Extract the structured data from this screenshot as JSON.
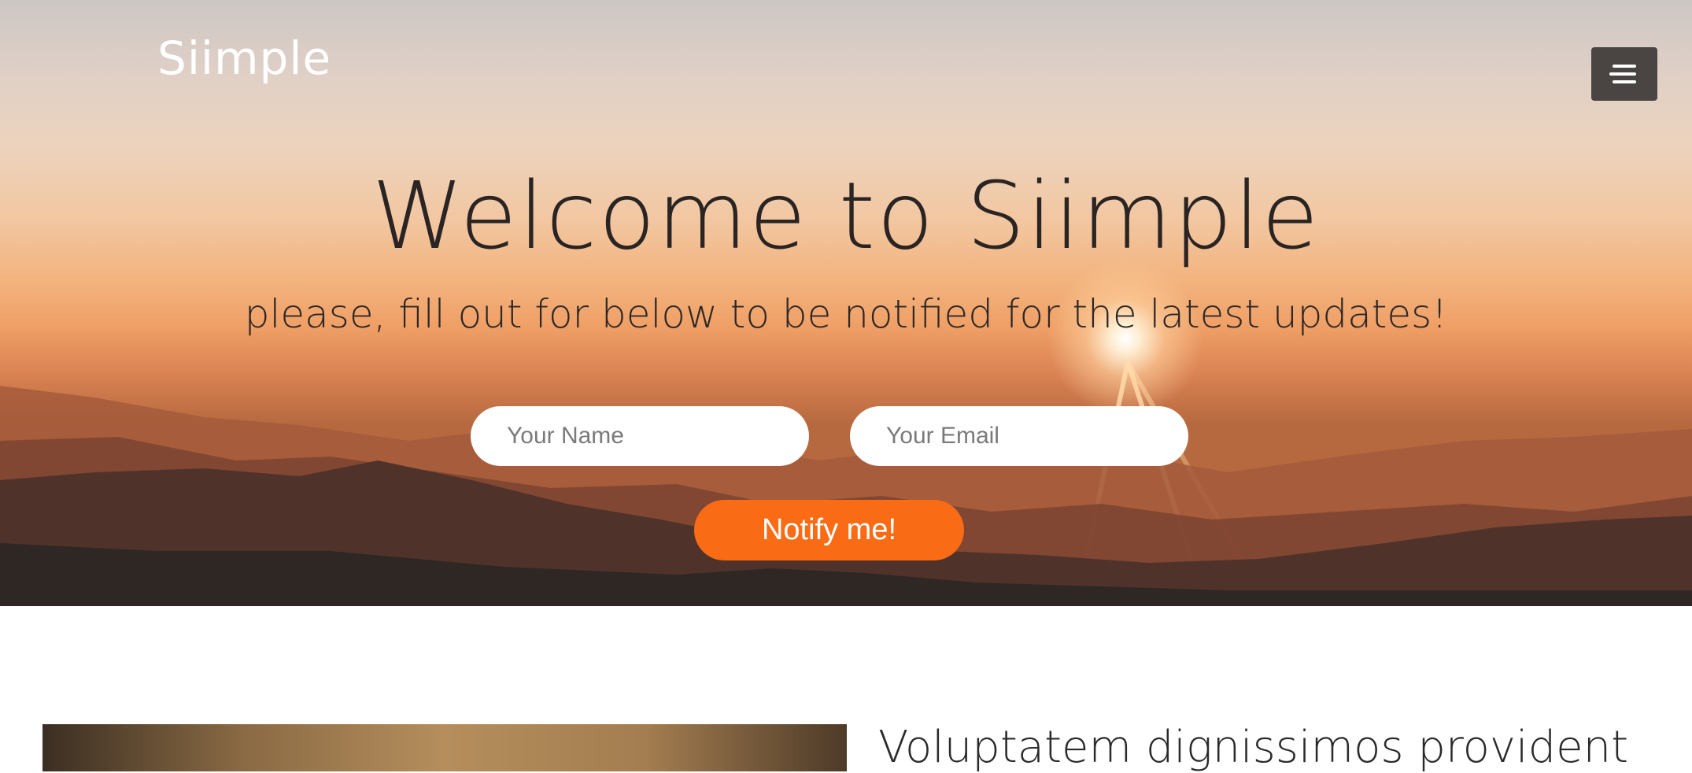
{
  "brand": {
    "logo_text": "Siimple"
  },
  "header": {
    "menu_icon": "hamburger-menu-icon"
  },
  "hero": {
    "title": "Welcome to Siimple",
    "subtitle": "please, fill out for below to be notified for the latest updates!",
    "form": {
      "name_placeholder": "Your Name",
      "email_placeholder": "Your Email",
      "submit_label": "Notify me!"
    }
  },
  "feature": {
    "heading": "Voluptatem dignissimos provident"
  },
  "colors": {
    "accent": "#f96b15",
    "menu_button": "#4a4543",
    "title_text": "#2a2523"
  }
}
